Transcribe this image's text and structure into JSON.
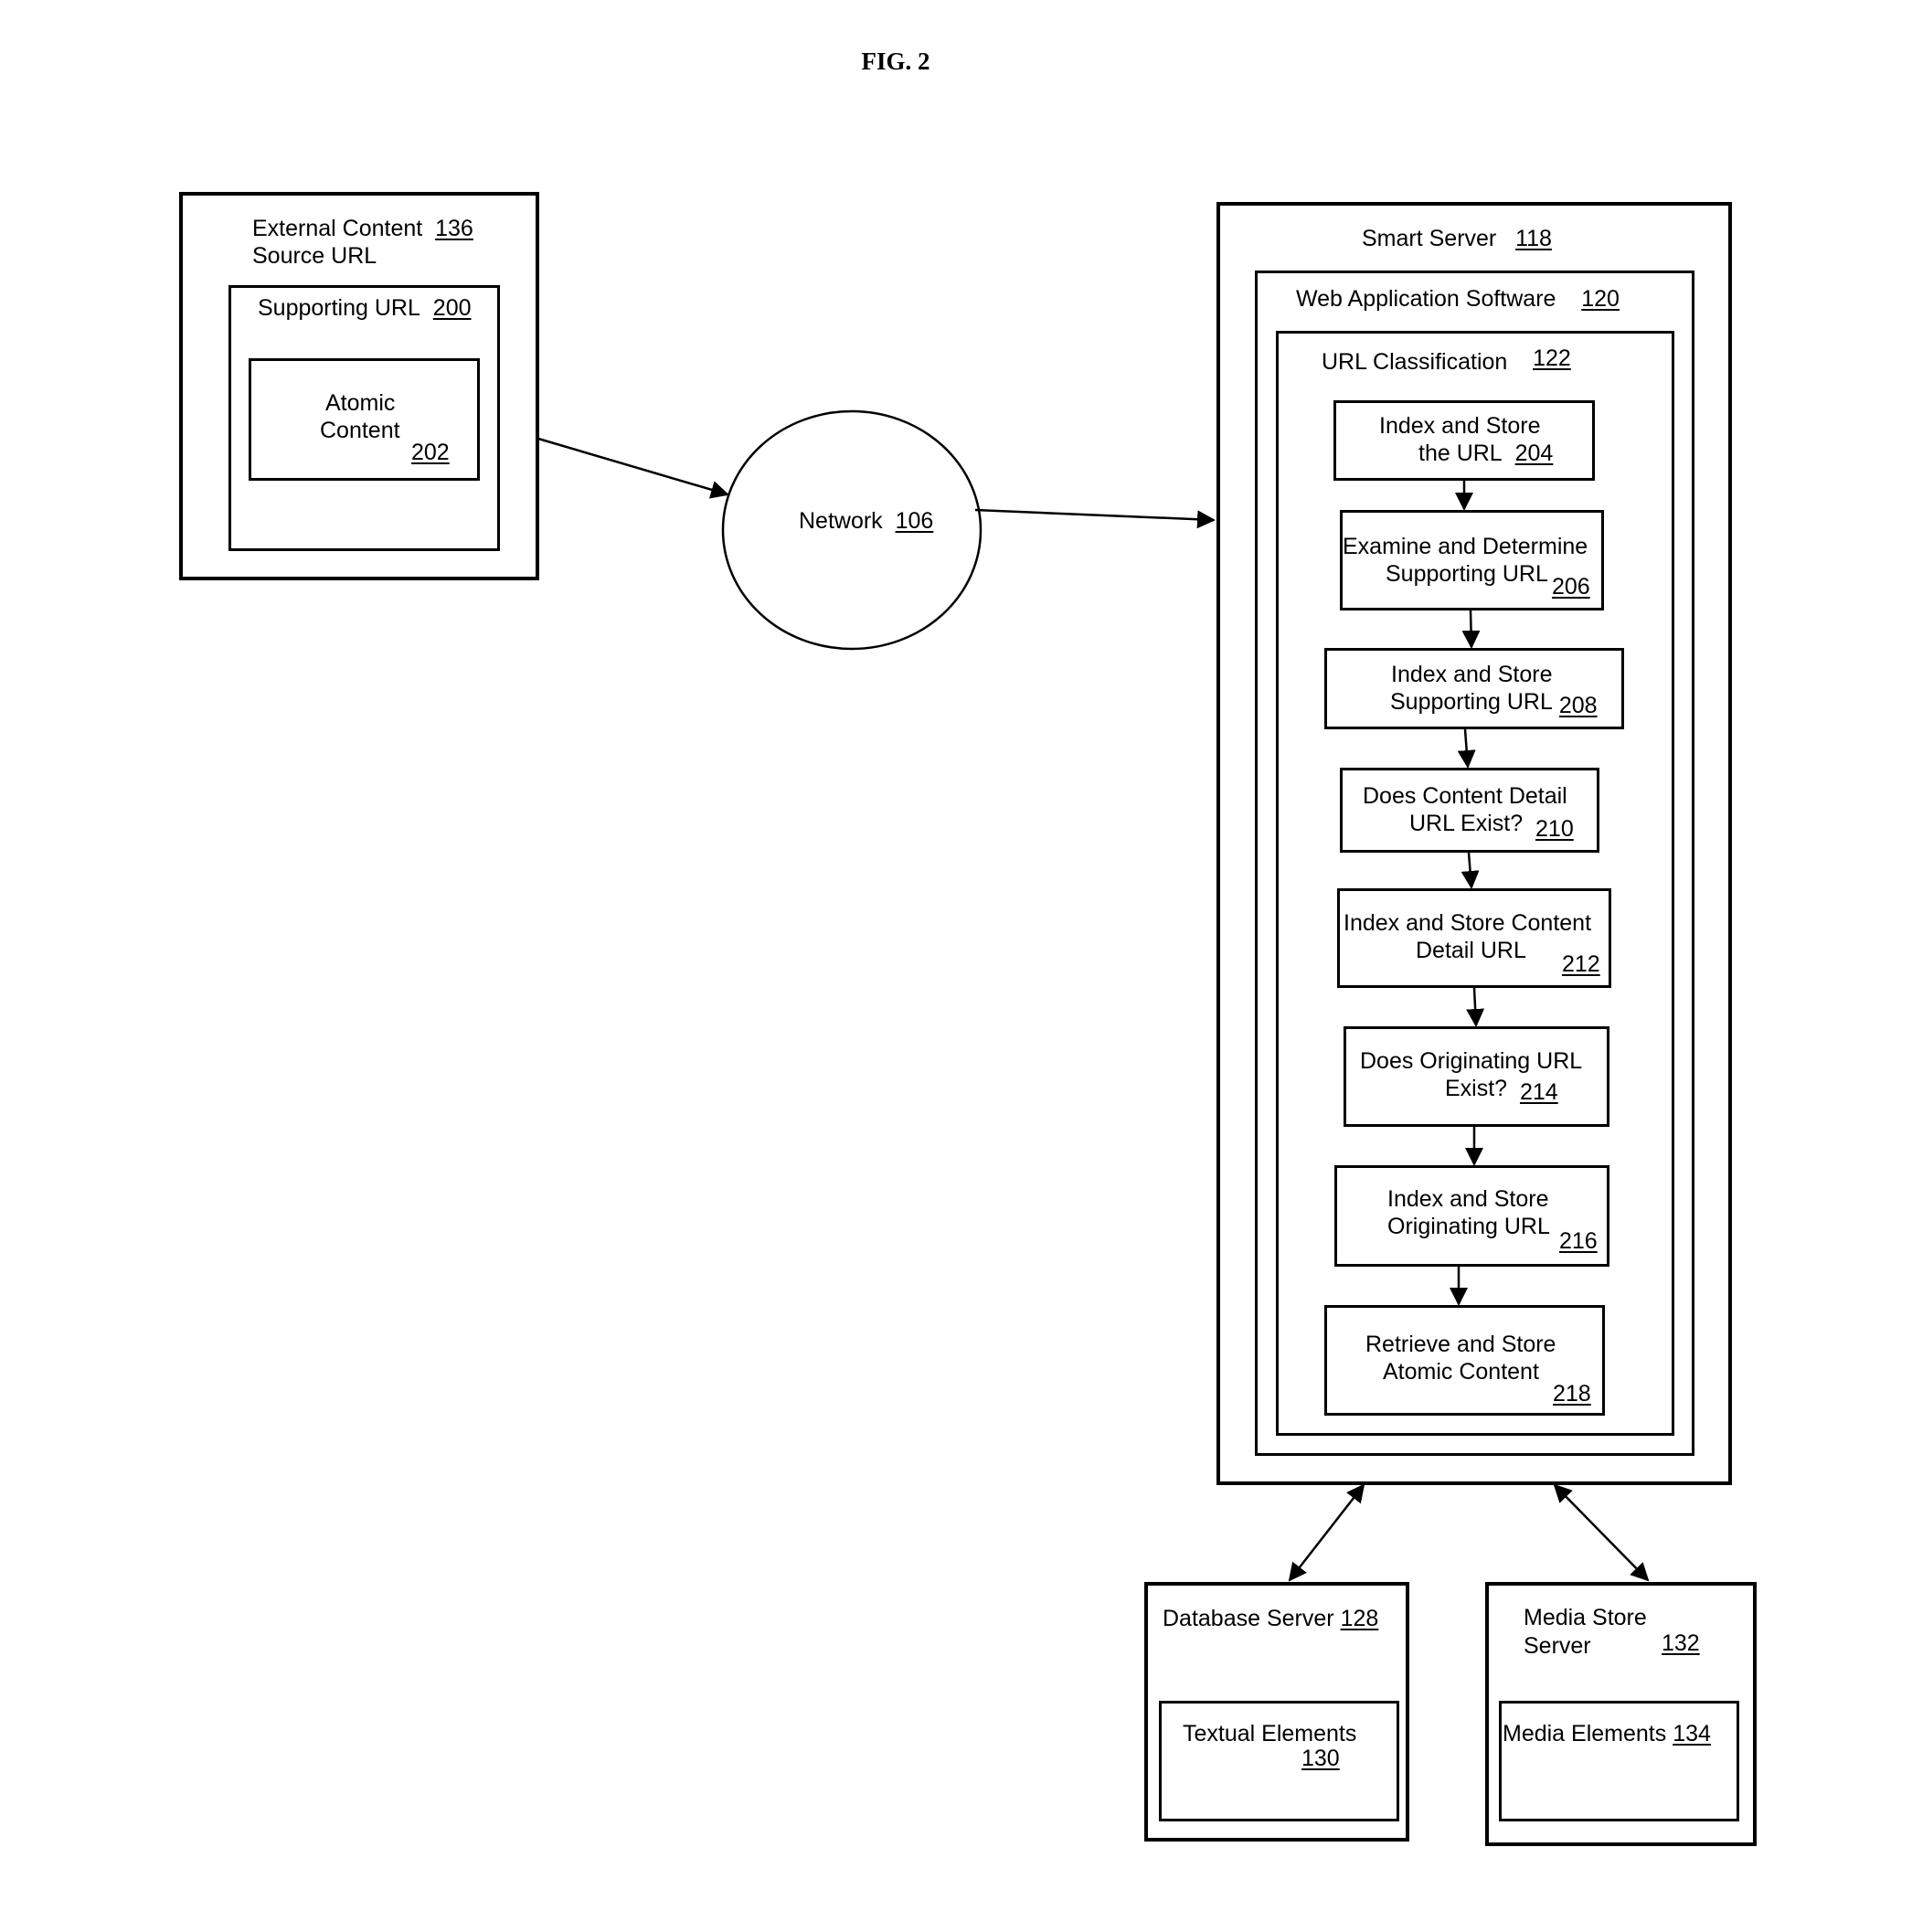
{
  "figure": {
    "title": "FIG. 2"
  },
  "external_content": {
    "label_line1": "External Content",
    "label_line2": "Source URL",
    "ref": "136",
    "supporting_url": {
      "label": "Supporting URL",
      "ref": "200"
    },
    "atomic_content": {
      "label_line1": "Atomic",
      "label_line2": "Content",
      "ref": "202"
    }
  },
  "network": {
    "label": "Network",
    "ref": "106"
  },
  "smart_server": {
    "label": "Smart Server",
    "ref": "118",
    "web_app": {
      "label": "Web Application Software",
      "ref": "120",
      "url_classification": {
        "label": "URL Classification",
        "ref": "122",
        "steps": [
          {
            "line1": "Index and Store",
            "line2": "the URL",
            "ref": "204"
          },
          {
            "line1": "Examine and Determine",
            "line2": "Supporting URL",
            "ref": "206"
          },
          {
            "line1": "Index and Store",
            "line2": "Supporting URL",
            "ref": "208"
          },
          {
            "line1": "Does Content Detail",
            "line2": "URL Exist?",
            "ref": "210"
          },
          {
            "line1": "Index and Store Content",
            "line2": "Detail URL",
            "ref": "212"
          },
          {
            "line1": "Does Originating URL",
            "line2": "Exist?",
            "ref": "214"
          },
          {
            "line1": "Index and Store",
            "line2": "Originating URL",
            "ref": "216"
          },
          {
            "line1": "Retrieve and Store",
            "line2": "Atomic Content",
            "ref": "218"
          }
        ]
      }
    }
  },
  "database_server": {
    "label": "Database Server",
    "ref": "128",
    "textual_elements": {
      "label": "Textual Elements",
      "ref": "130"
    }
  },
  "media_store_server": {
    "label_line1": "Media Store",
    "label_line2": "Server",
    "ref": "132",
    "media_elements": {
      "label": "Media Elements",
      "ref": "134"
    }
  },
  "connections": [
    {
      "from": "External Content 136",
      "to": "Network 106",
      "type": "arrow"
    },
    {
      "from": "Network 106",
      "to": "Smart Server 118",
      "type": "arrow"
    },
    {
      "from": "Smart Server 118",
      "to": "Database Server 128",
      "type": "bidirectional"
    },
    {
      "from": "Smart Server 118",
      "to": "Media Store Server 132",
      "type": "bidirectional"
    },
    {
      "from": "204",
      "to": "206",
      "type": "arrow"
    },
    {
      "from": "206",
      "to": "208",
      "type": "arrow"
    },
    {
      "from": "208",
      "to": "210",
      "type": "arrow"
    },
    {
      "from": "210",
      "to": "212",
      "type": "arrow"
    },
    {
      "from": "212",
      "to": "214",
      "type": "arrow"
    },
    {
      "from": "214",
      "to": "216",
      "type": "arrow"
    },
    {
      "from": "216",
      "to": "218",
      "type": "arrow"
    }
  ]
}
